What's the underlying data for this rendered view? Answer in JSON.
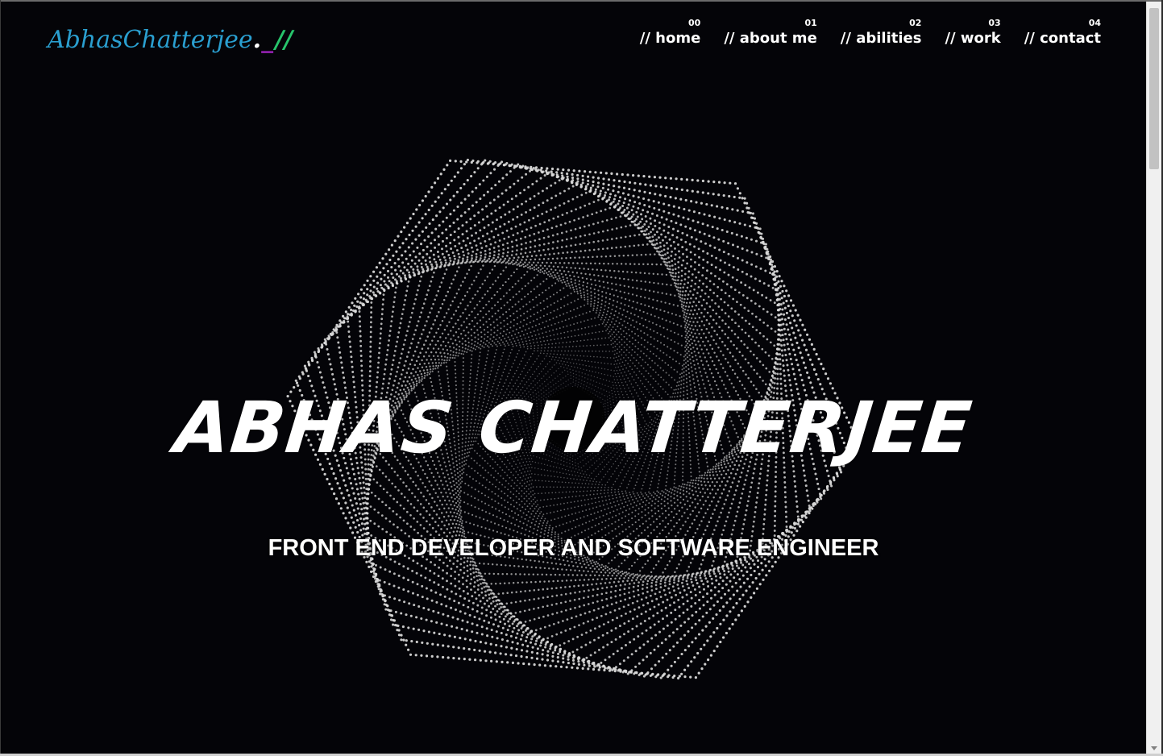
{
  "logo": {
    "name": "AbhasChatterjee",
    "dot": ".",
    "underscore": "_",
    "slashes": "//"
  },
  "nav": {
    "items": [
      {
        "num": "00",
        "label": "// home"
      },
      {
        "num": "01",
        "label": "// about me"
      },
      {
        "num": "02",
        "label": "// abilities"
      },
      {
        "num": "03",
        "label": "// work"
      },
      {
        "num": "04",
        "label": "// contact"
      }
    ]
  },
  "hero": {
    "title": "ABHAS CHATTERJEE",
    "subtitle": "FRONT END DEVELOPER AND SOFTWARE ENGINEER",
    "graphic": "dotted-hexagon-spiral"
  },
  "colors": {
    "background": "#040408",
    "logo_name": "#2a9fd0",
    "logo_underscore": "#8b1fa6",
    "logo_slashes": "#27c46b",
    "text": "#ffffff",
    "dots": "#d8d8d8"
  }
}
